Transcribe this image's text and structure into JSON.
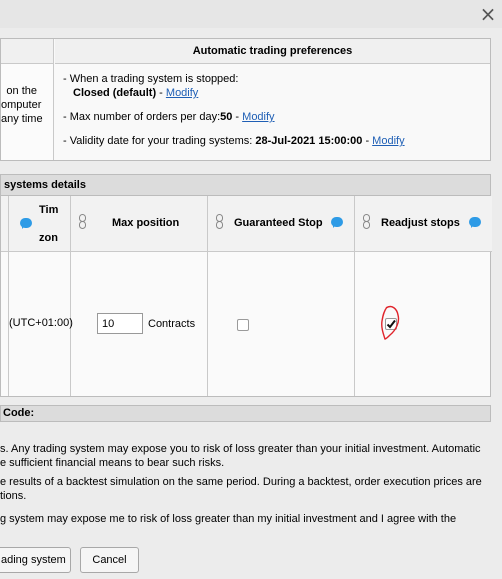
{
  "window": {
    "close_label": "×"
  },
  "preferences": {
    "left_fragments": [
      "on the",
      "omputer",
      "any time"
    ],
    "header": "Automatic trading preferences",
    "stopped_label": "- When a trading system is stopped:",
    "stopped_value": "Closed (default)",
    "separator": " - ",
    "modify_label": "Modify",
    "max_orders_label": "- Max number of orders per day:",
    "max_orders_value": "50",
    "validity_label": "- Validity date for your trading systems: ",
    "validity_value": "28-Jul-2021 15:00:00"
  },
  "systems": {
    "header": "systems details",
    "timezone_header_top": "Tim",
    "timezone_header_bottom": "zon",
    "max_position_header": "Max position",
    "guaranteed_stop_header": "Guaranteed Stop",
    "readjust_stops_header": "Readjust stops",
    "timezone_value": "(UTC+01:00)",
    "max_position_value": "10",
    "max_position_unit": "Contracts",
    "guaranteed_stop_checked": false,
    "readjust_stops_checked": true
  },
  "code_row": {
    "label": "Code:"
  },
  "disclaimer": {
    "line1": "s. Any trading system may expose you to risk of loss greater than your initial investment. Automatic",
    "line2": "e sufficient financial means to bear such risks.",
    "line3": "e results of a backtest simulation on the same period. During a backtest, order execution prices are",
    "line4": "tions.",
    "line5": "g system may expose me to risk of loss greater than my initial investment and I agree with the"
  },
  "buttons": {
    "start_label": "ading system",
    "cancel_label": "Cancel"
  },
  "colors": {
    "link": "#1f5fb5",
    "bubble": "#2e9be6",
    "annotation": "#e0242b"
  }
}
